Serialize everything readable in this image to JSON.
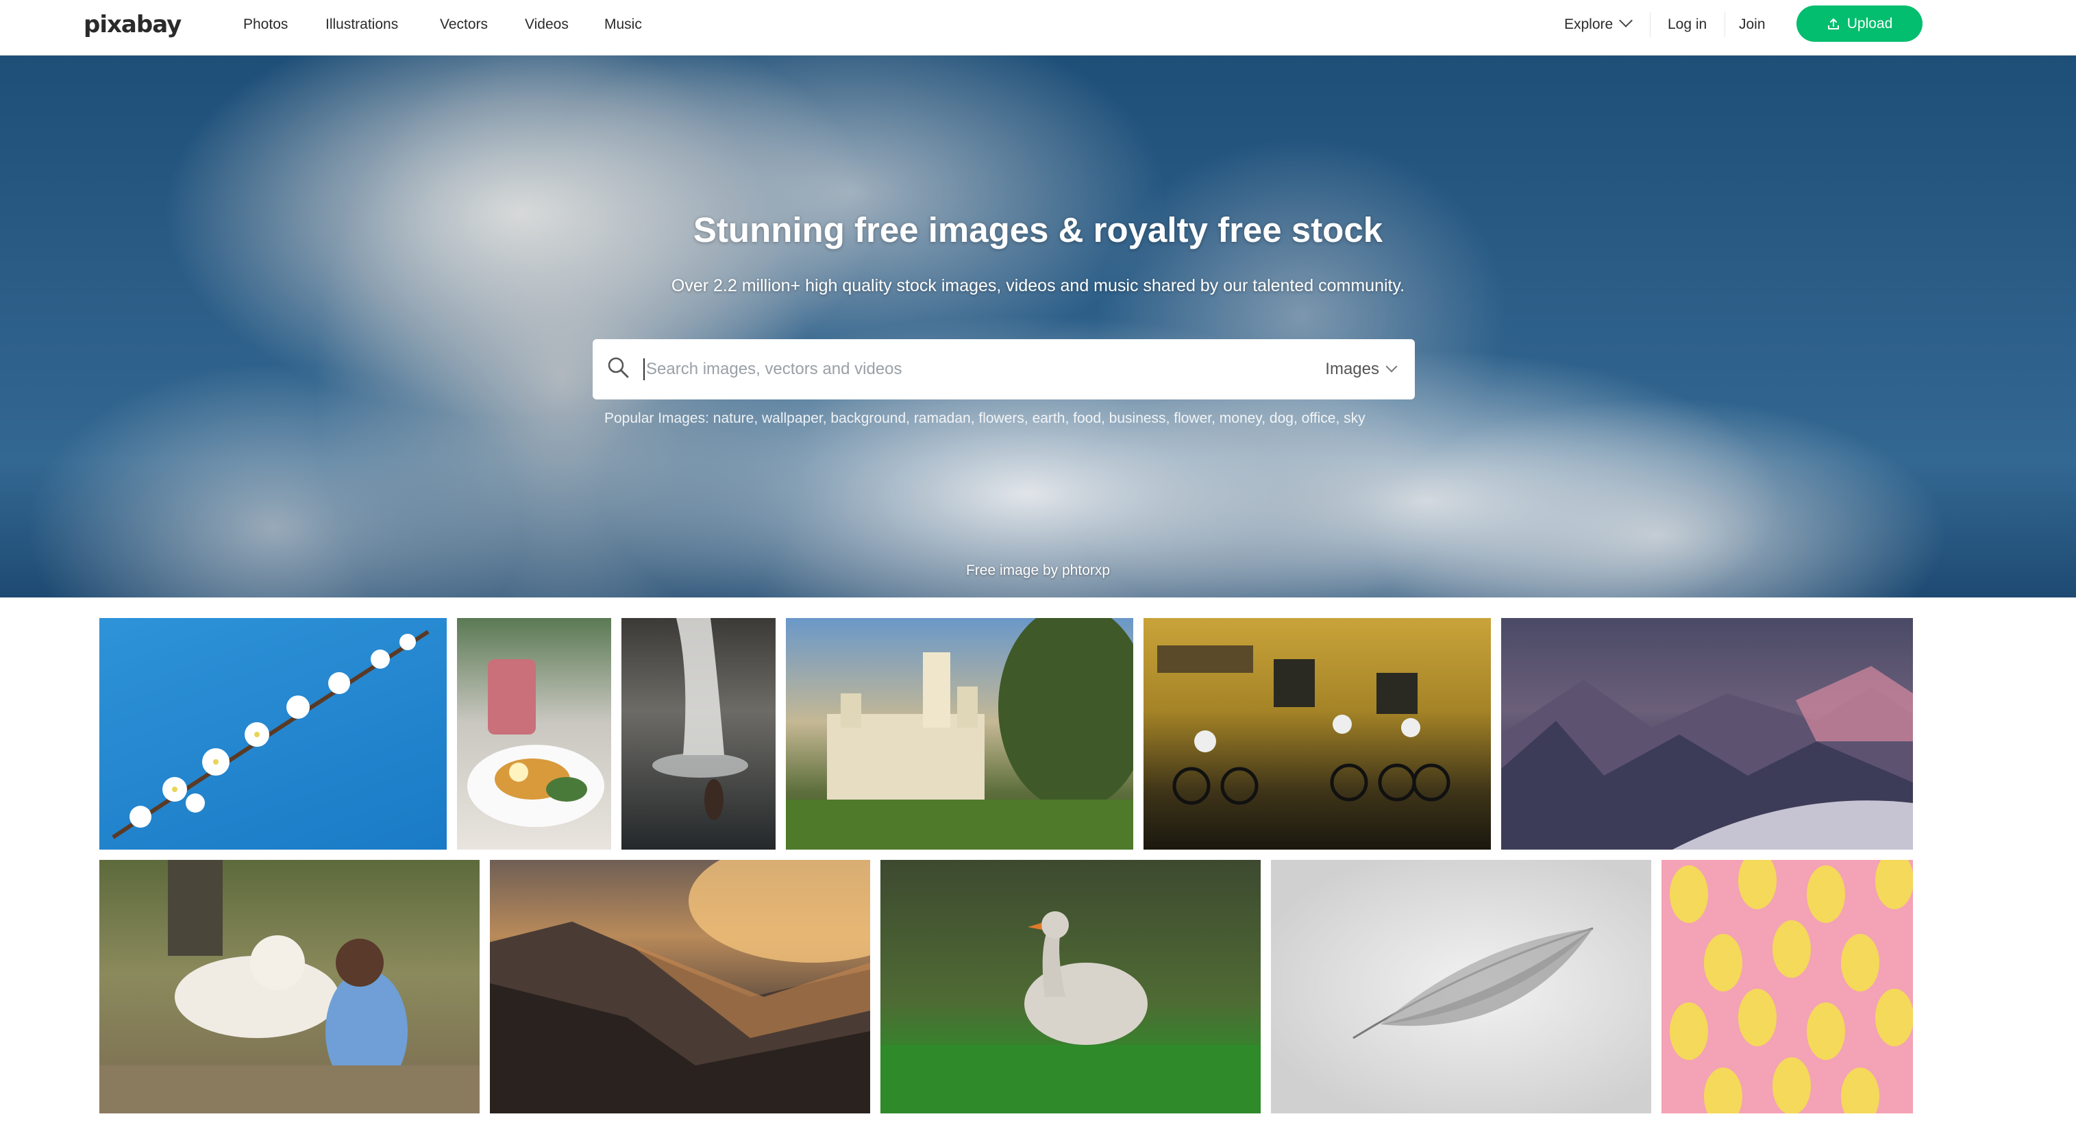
{
  "header": {
    "logo": "pixabay",
    "nav": [
      "Photos",
      "Illustrations",
      "Vectors",
      "Videos",
      "Music"
    ],
    "explore_label": "Explore",
    "login_label": "Log in",
    "join_label": "Join",
    "upload_label": "Upload"
  },
  "hero": {
    "title": "Stunning free images & royalty free stock",
    "subtitle": "Over 2.2 million+ high quality stock images, videos and music shared by our talented community.",
    "search_placeholder": "Search images, vectors and videos",
    "search_type": "Images",
    "popular_label": "Popular Images:",
    "popular_tags": [
      "nature",
      "wallpaper",
      "background",
      "ramadan",
      "flowers",
      "earth",
      "food",
      "business",
      "flower",
      "money",
      "dog",
      "office",
      "sky"
    ],
    "credit": "Free image by phtorxp"
  },
  "gallery": [
    {
      "subject": "cherry-blossom-branch"
    },
    {
      "subject": "smoothie-and-breakfast"
    },
    {
      "subject": "waterfall-woman"
    },
    {
      "subject": "castle"
    },
    {
      "subject": "cyclists-flooded-street"
    },
    {
      "subject": "mountain-night-illustration"
    },
    {
      "subject": "dog-and-girl"
    },
    {
      "subject": "mountain-sunset"
    },
    {
      "subject": "goose-on-grass"
    },
    {
      "subject": "feather"
    },
    {
      "subject": "lemon-pattern"
    }
  ],
  "colors": {
    "upload_button": "#02be6e",
    "hero_sky": "#2a5c86"
  },
  "icons": [
    "search-icon",
    "chevron-down-icon",
    "upload-icon"
  ]
}
